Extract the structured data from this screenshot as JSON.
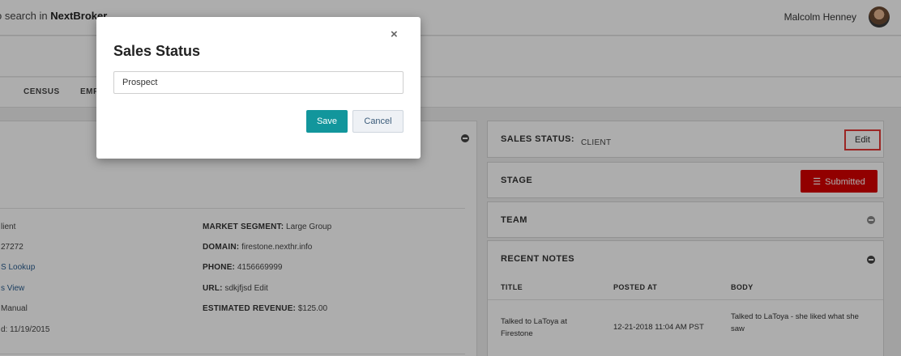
{
  "header": {
    "search_prefix": "o search in ",
    "search_brand": "NextBroker",
    "user_name": "Malcolm Henney"
  },
  "tabs": [
    "CENSUS",
    "EMP"
  ],
  "left_panel": {
    "left_col": [
      "lient",
      "27272",
      "S Lookup",
      "s View",
      "Manual",
      "d: 11/19/2015"
    ],
    "right_col": [
      {
        "label": "MARKET SEGMENT:",
        "value": "Large Group"
      },
      {
        "label": "DOMAIN:",
        "value": "firestone.nexthr.info"
      },
      {
        "label": "PHONE:",
        "value": "4156669999"
      },
      {
        "label": "URL:",
        "value": "sdkjfjsd Edit"
      },
      {
        "label": "ESTIMATED REVENUE:",
        "value": "$125.00"
      }
    ]
  },
  "sales_status": {
    "title": "SALES STATUS:",
    "value": "CLIENT",
    "edit_label": "Edit"
  },
  "stage": {
    "title": "STAGE",
    "button_label": "Submitted"
  },
  "team": {
    "title": "TEAM"
  },
  "recent_notes": {
    "title": "RECENT NOTES",
    "columns": [
      "TITLE",
      "POSTED AT",
      "BODY"
    ],
    "rows": [
      {
        "title_l1": "Talked to LaToya at",
        "title_l2": "Firestone",
        "posted": "12-21-2018 11:04 AM PST",
        "body_l1": "Talked to LaToya - she liked what she",
        "body_l2": "saw"
      }
    ]
  },
  "modal": {
    "title": "Sales Status",
    "close": "×",
    "input_value": "Prospect",
    "save_label": "Save",
    "cancel_label": "Cancel"
  },
  "colors": {
    "accent_teal": "#12969c",
    "submitted_red": "#d70000",
    "highlight_red": "#e53935"
  }
}
